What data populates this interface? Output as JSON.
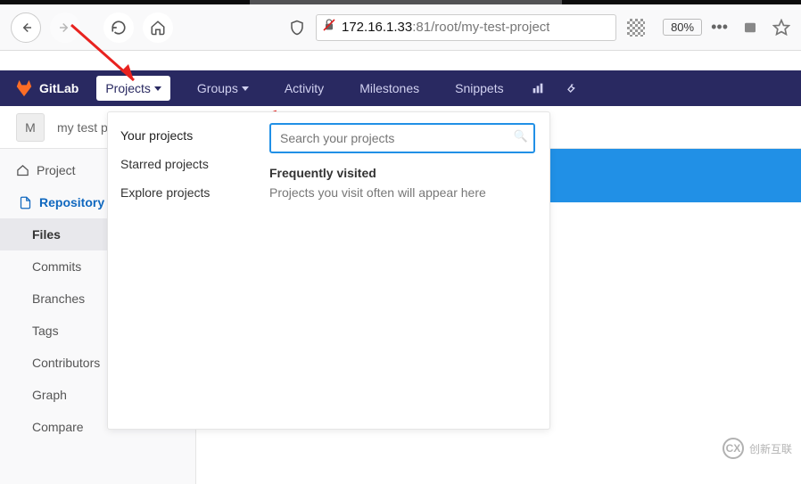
{
  "browser": {
    "url_host": "172.16.1.33",
    "url_port": ":81",
    "url_path": "/root/my-test-project",
    "zoom": "80%"
  },
  "topnav": {
    "brand": "GitLab",
    "projects": "Projects",
    "groups": "Groups",
    "activity": "Activity",
    "milestones": "Milestones",
    "snippets": "Snippets"
  },
  "breadcrumb": {
    "avatar_letter": "M",
    "project_name": "my test p"
  },
  "dropdown": {
    "left_items": [
      "Your projects",
      "Starred projects",
      "Explore projects"
    ],
    "search_placeholder": "Search your projects",
    "heading": "Frequently visited",
    "empty_text": "Projects you visit often will appear here"
  },
  "sidebar": {
    "items": [
      {
        "label": "Project",
        "icon": "home-icon",
        "level": 1
      },
      {
        "label": "Repository",
        "icon": "doc-icon",
        "level": 1,
        "active": true
      },
      {
        "label": "Files",
        "level": 2,
        "active": true
      },
      {
        "label": "Commits",
        "level": 2
      },
      {
        "label": "Branches",
        "level": 2
      },
      {
        "label": "Tags",
        "level": 2
      },
      {
        "label": "Contributors",
        "level": 2
      },
      {
        "label": "Graph",
        "level": 2
      },
      {
        "label": "Compare",
        "level": 2
      }
    ]
  },
  "watermark": {
    "text": "创新互联"
  }
}
